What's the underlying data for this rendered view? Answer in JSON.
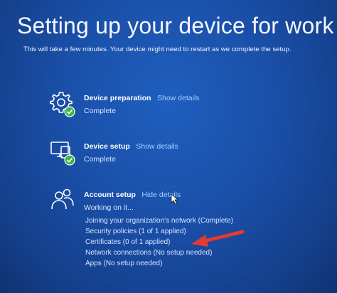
{
  "page": {
    "title": "Setting up your device for work",
    "subtitle": "This will take a few minutes. Your device might need to restart as we complete the setup."
  },
  "sections": [
    {
      "icon": "gear-check-icon",
      "title": "Device preparation",
      "link": "Show details",
      "status": "Complete"
    },
    {
      "icon": "devices-check-icon",
      "title": "Device setup",
      "link": "Show details",
      "status": "Complete"
    },
    {
      "icon": "people-icon",
      "title": "Account setup",
      "link": "Hide details",
      "status": "Working on it..."
    }
  ],
  "account_details": [
    "Joining your organization's network (Complete)",
    "Security policies (1 of 1 applied)",
    "Certificates (0 of 1 applied)",
    "Network connections (No setup needed)",
    "Apps (No setup needed)"
  ],
  "colors": {
    "background": "#1a4fa8",
    "link": "#9fd2ff",
    "check_badge": "#3cb54a",
    "annotation_arrow": "#e53935"
  }
}
